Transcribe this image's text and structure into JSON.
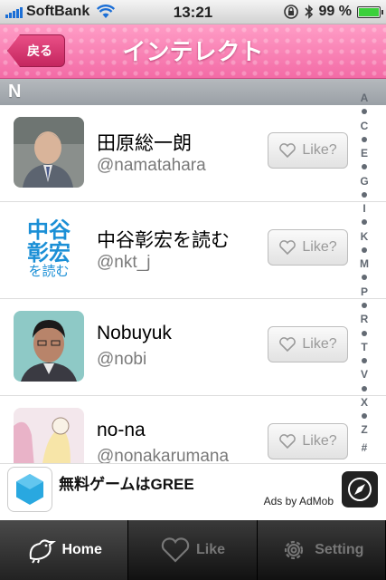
{
  "status": {
    "carrier": "SoftBank",
    "time": "13:21",
    "battery": "99 %",
    "battery_level": 0.99
  },
  "nav": {
    "back_label": "戻る",
    "title": "インテレクト"
  },
  "section": {
    "header": "N"
  },
  "list": [
    {
      "name": "田原総一朗",
      "handle": "@namatahara",
      "like_label": "Like?"
    },
    {
      "name": "中谷彰宏を読む",
      "handle": "@nkt_j",
      "like_label": "Like?"
    },
    {
      "name": "Nobuyuk",
      "handle": "@nobi",
      "like_label": "Like?"
    },
    {
      "name": "no-na",
      "handle": "@nonakarumana",
      "like_label": "Like?"
    }
  ],
  "avatar_text": {
    "line1": "中谷",
    "line2": "彰宏",
    "line3": "を読む"
  },
  "index": [
    "A",
    "•",
    "C",
    "•",
    "E",
    "•",
    "G",
    "•",
    "I",
    "•",
    "K",
    "•",
    "M",
    "•",
    "P",
    "•",
    "R",
    "•",
    "T",
    "•",
    "V",
    "•",
    "X",
    "•",
    "Z",
    "#"
  ],
  "ad": {
    "title": "無料ゲームはGREE",
    "by": "Ads by AdMob"
  },
  "tabs": [
    {
      "label": "Home",
      "icon": "bird-icon"
    },
    {
      "label": "Like",
      "icon": "heart-icon"
    },
    {
      "label": "Setting",
      "icon": "gear-icon"
    }
  ]
}
